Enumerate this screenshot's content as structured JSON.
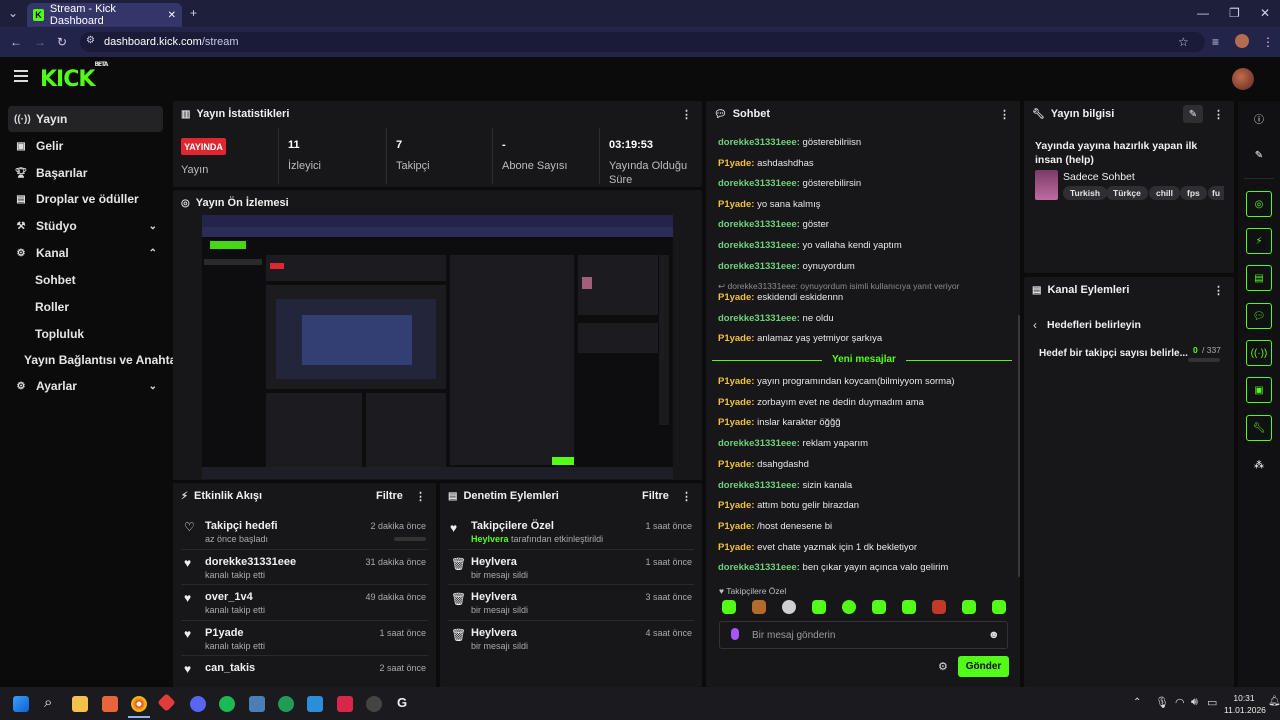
{
  "browser": {
    "tab_title": "Stream - Kick Dashboard",
    "url_host": "dashboard.kick.com",
    "url_path": "/stream"
  },
  "brand": {
    "logo": "KICK",
    "logo_badge": "BETA",
    "accent": "#53fc18"
  },
  "sidebar": {
    "items": [
      {
        "label": "Yayın",
        "icon": "broadcast-icon"
      },
      {
        "label": "Gelir",
        "icon": "money-icon"
      },
      {
        "label": "Başarılar",
        "icon": "trophy-icon"
      },
      {
        "label": "Droplar ve ödüller",
        "icon": "gift-icon"
      },
      {
        "label": "Stüdyo",
        "icon": "studio-icon"
      },
      {
        "label": "Kanal",
        "icon": "channel-icon"
      },
      {
        "label": "Ayarlar",
        "icon": "gear-icon"
      }
    ],
    "channel_sub": [
      "Sohbet",
      "Roller",
      "Topluluk",
      "Yayın Bağlantısı ve Anahtarı"
    ]
  },
  "stats": {
    "title": "Yayın İstatistikleri",
    "live_badge": "YAYINDA",
    "live_label": "Yayın",
    "viewers_value": "11",
    "viewers_label": "İzleyici",
    "followers_value": "7",
    "followers_label": "Takipçi",
    "subs_value": "-",
    "subs_label": "Abone Sayısı",
    "uptime_value": "03:19:53",
    "uptime_label_1": "Yayında Olduğu",
    "uptime_label_2": "Süre"
  },
  "preview": {
    "title": "Yayın Ön İzlemesi"
  },
  "events": {
    "title": "Etkinlik Akışı",
    "filter": "Filtre",
    "items": [
      {
        "name": "Takipçi hedefi",
        "sub": "az önce başladı",
        "time": "2 dakika önce"
      },
      {
        "name": "dorekke31331eee",
        "sub": "kanalı takip etti",
        "time": "31 dakika önce"
      },
      {
        "name": "over_1v4",
        "sub": "kanalı takip etti",
        "time": "49 dakika önce"
      },
      {
        "name": "P1yade",
        "sub": "kanalı takip etti",
        "time": "1 saat önce"
      },
      {
        "name": "can_takis",
        "sub": "",
        "time": "2 saat önce"
      }
    ]
  },
  "moderation": {
    "title": "Denetim Eylemleri",
    "filter": "Filtre",
    "items": [
      {
        "name": "Takipçilere Özel",
        "actor": "Heylvera",
        "sub": "tarafından etkinleştirildi",
        "time": "1 saat önce"
      },
      {
        "name": "Heylvera",
        "sub": "bir mesajı sildi",
        "time": "1 saat önce"
      },
      {
        "name": "Heylvera",
        "sub": "bir mesajı sildi",
        "time": "3 saat önce"
      },
      {
        "name": "Heylvera",
        "sub": "bir mesajı sildi",
        "time": "4 saat önce"
      }
    ]
  },
  "chat": {
    "title": "Sohbet",
    "messages_before": [
      {
        "user": "dorekke31331eee",
        "text": "gösterebilriisn",
        "color": "green"
      },
      {
        "user": "P1yade",
        "text": "ashdashdhas",
        "color": "yellow"
      },
      {
        "user": "dorekke31331eee",
        "text": "gösterebilirsin",
        "color": "green"
      },
      {
        "user": "P1yade",
        "text": "yo sana kalmış",
        "color": "yellow"
      },
      {
        "user": "dorekke31331eee",
        "text": "göster",
        "color": "green"
      },
      {
        "user": "dorekke31331eee",
        "text": "yo vallaha kendi yaptım",
        "color": "green"
      },
      {
        "user": "dorekke31331eee",
        "text": "oynuyordum",
        "color": "green"
      }
    ],
    "reply_hint": "dorekke31331eee: oynuyordum isimli kullanıcıya yanıt veriyor",
    "messages_mid": [
      {
        "user": "P1yade",
        "text": "eskidendi eskidennn",
        "color": "yellow"
      },
      {
        "user": "dorekke31331eee",
        "text": "ne oldu",
        "color": "green"
      },
      {
        "user": "P1yade",
        "text": "anlamaz yaş yetmiyor şarkıya",
        "color": "yellow"
      }
    ],
    "new_messages_label": "Yeni mesajlar",
    "messages_after": [
      {
        "user": "P1yade",
        "text": "yayın programından koycam(bilmiyyom sorma)",
        "color": "yellow"
      },
      {
        "user": "P1yade",
        "text": "zorbayım evet ne dedin duymadım ama",
        "color": "yellow"
      },
      {
        "user": "P1yade",
        "text": "inslar karakter öğğğ",
        "color": "yellow"
      },
      {
        "user": "dorekke31331eee",
        "text": "reklam yaparım",
        "color": "green"
      },
      {
        "user": "P1yade",
        "text": "dsahgdashd",
        "color": "yellow"
      },
      {
        "user": "dorekke31331eee",
        "text": "sizin kanala",
        "color": "green"
      },
      {
        "user": "P1yade",
        "text": "attım botu gelir birazdan",
        "color": "yellow"
      },
      {
        "user": "P1yade",
        "text": "/host denesene bi",
        "color": "yellow"
      },
      {
        "user": "P1yade",
        "text": "evet chate yazmak için 1 dk bekletiyor",
        "color": "yellow"
      },
      {
        "user": "dorekke31331eee",
        "text": "ben çıkar yayın açınca valo gelirim",
        "color": "green"
      }
    ],
    "followers_only": "Takipçilere Özel",
    "input_placeholder": "Bir mesaj gönderin",
    "send_label": "Gönder"
  },
  "stream_info": {
    "title": "Yayın bilgisi",
    "stream_title": "Yayında yayına hazırlık yapan ilk insan (help)",
    "category": "Sadece Sohbet",
    "tags": [
      "Turkish",
      "Türkçe",
      "chill",
      "fps",
      "fu"
    ]
  },
  "channel_actions": {
    "title": "Kanal Eylemleri",
    "back_label": "Hedefleri belirleyin",
    "goal_text": "Hedef bir takipçi sayısı belirle...",
    "goal_current": "0",
    "goal_total": "/ 337",
    "goal_progress": 0
  },
  "taskbar": {
    "time": "10:31",
    "date": "11.01.2026"
  }
}
